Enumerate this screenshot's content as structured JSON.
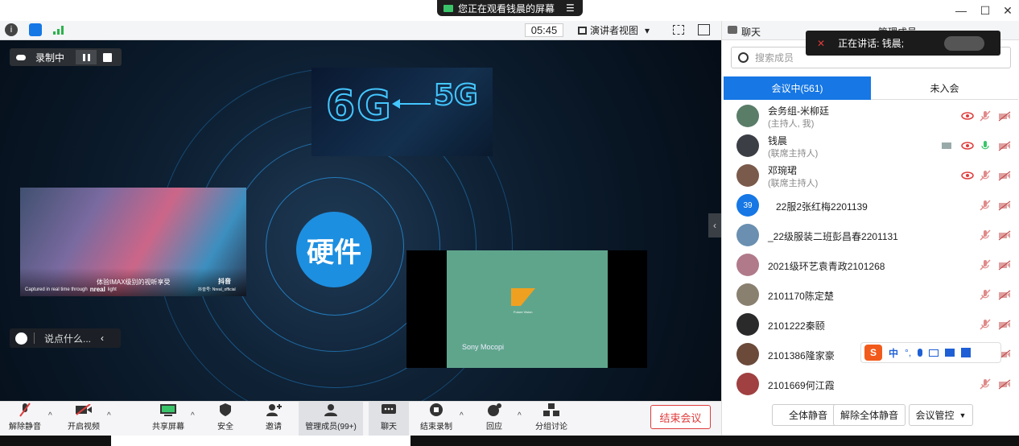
{
  "share_banner": {
    "text": "您正在观看钱晨的屏幕",
    "menu_icon": "menu-icon"
  },
  "window": {
    "minimize": "—",
    "maximize": "☐",
    "close": "✕"
  },
  "toolbar": {
    "time": "05:45",
    "view_label": "演讲者视图",
    "view_caret": "▾"
  },
  "stage": {
    "recording_label": "录制中",
    "say_placeholder": "说点什么...",
    "center_label": "硬件",
    "slide_6g": "6G",
    "slide_5g": "5G",
    "left_video_caption": "体验IMAX级别的视听享受",
    "left_video_sub": "Captured in real time through",
    "left_video_brand": "nreal",
    "left_video_brand2": "light",
    "left_video_tiktok": "抖音",
    "left_video_id": "抖音号: Nreal_official",
    "green_title": "Future Vision",
    "green_caption": "Sony Mocopi"
  },
  "bottombar": {
    "unmute": "解除静音",
    "video": "开启视频",
    "share": "共享屏幕",
    "security": "安全",
    "invite": "邀请",
    "members": "管理成员(99+)",
    "chat": "聊天",
    "end_record": "结束录制",
    "react": "回应",
    "breakout": "分组讨论",
    "end_meeting": "结束会议"
  },
  "panel": {
    "chat_tab": "聊天",
    "members_tab": "管理成员",
    "speaking_text": "正在讲话: 钱晨;",
    "search_placeholder": "搜索成员",
    "tab_in_meeting": "会议中(561)",
    "tab_not_joined": "未入会",
    "mute_all": "全体静音",
    "unmute_all": "解除全体静音",
    "meeting_control": "会议管控"
  },
  "members": [
    {
      "name": "会务组-米柳廷",
      "role": "(主持人, 我)",
      "avatar_color": "#5a7d68"
    },
    {
      "name": "钱晨",
      "role": "(联席主持人)",
      "avatar_color": "#3b3f45"
    },
    {
      "name": "邓琬珺",
      "role": "(联席主持人)",
      "avatar_color": "#7a5a4a"
    },
    {
      "name": "22服2张红梅2201139",
      "role": "",
      "avatar_color": "#1677e5",
      "avatar_text": "39"
    },
    {
      "name": "_22级服装二班彭昌春2201131",
      "role": "",
      "avatar_color": "#6a8fb0"
    },
    {
      "name": "2021级环艺袁青政2101268",
      "role": "",
      "avatar_color": "#b07a8a"
    },
    {
      "name": "2101170陈定楚",
      "role": "",
      "avatar_color": "#8a8070"
    },
    {
      "name": "2101222秦颐",
      "role": "",
      "avatar_color": "#2a2a2a"
    },
    {
      "name": "2101386隆家豪",
      "role": "",
      "avatar_color": "#6b4a3a"
    },
    {
      "name": "2101669何江霞",
      "role": "",
      "avatar_color": "#a04040"
    }
  ],
  "ime": {
    "lang": "中",
    "punct": "°,"
  }
}
